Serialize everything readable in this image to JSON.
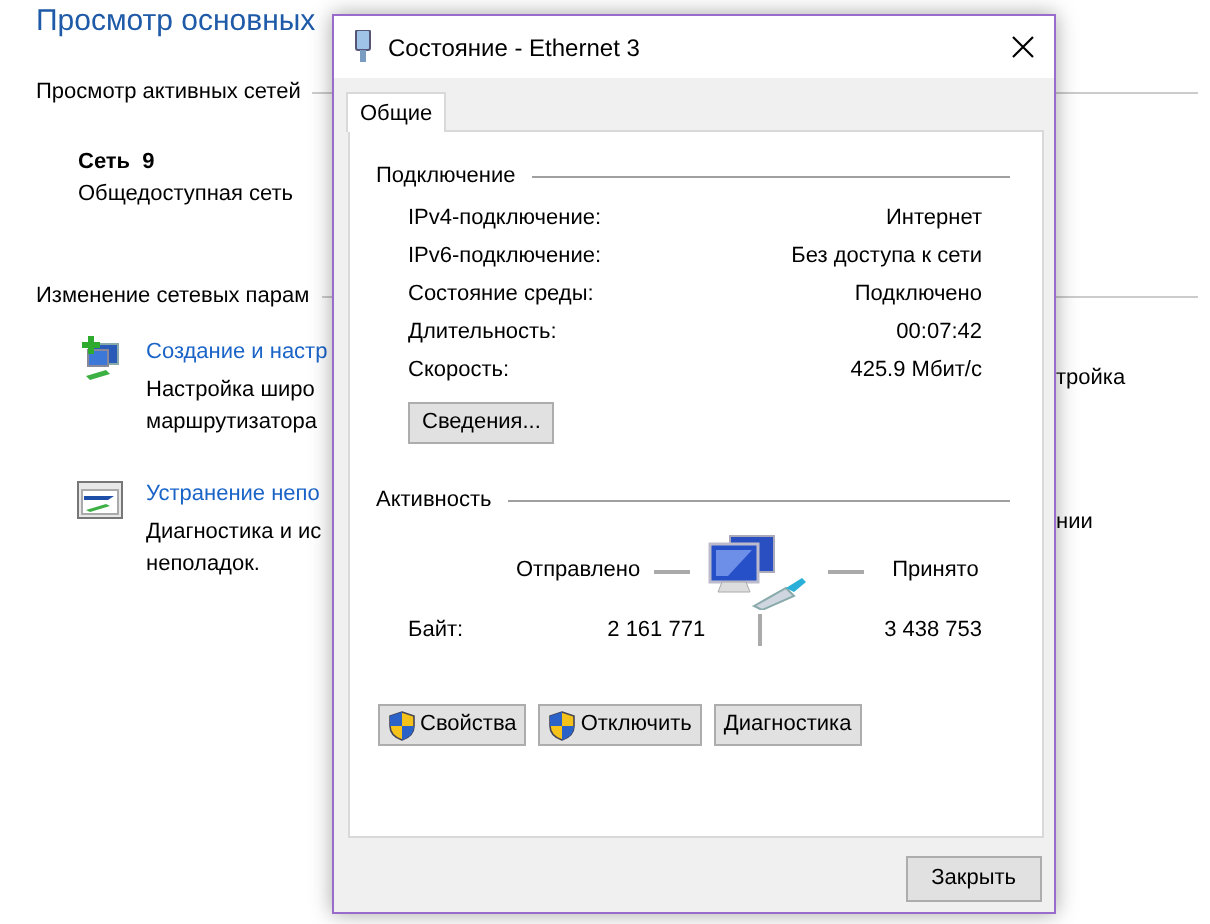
{
  "background": {
    "title": "Просмотр основных",
    "active_networks_heading": "Просмотр активных сетей",
    "network": {
      "name": "Сеть  9",
      "category": "Общедоступная сеть"
    },
    "settings_heading": "Изменение сетевых парам",
    "tasks": [
      {
        "kind": "setup",
        "link": "Создание и настр",
        "lines": [
          "Настройка широ",
          "маршрутизатора"
        ],
        "right_fragment": "тройка"
      },
      {
        "kind": "troubleshoot",
        "link": "Устранение непо",
        "lines": [
          "Диагностика и ис",
          "неполадок."
        ],
        "right_fragment": "нии"
      }
    ]
  },
  "dialog": {
    "title": "Состояние - Ethernet 3",
    "tabs": [
      {
        "label": "Общие",
        "selected": true
      }
    ],
    "connection": {
      "heading": "Подключение",
      "rows": [
        {
          "label": "IPv4-подключение:",
          "value": "Интернет"
        },
        {
          "label": "IPv6-подключение:",
          "value": "Без доступа к сети"
        },
        {
          "label": "Состояние среды:",
          "value": "Подключено"
        },
        {
          "label": "Длительность:",
          "value": "00:07:42"
        },
        {
          "label": "Скорость:",
          "value": "425.9 Мбит/с"
        }
      ],
      "details_button": "Сведения..."
    },
    "activity": {
      "heading": "Активность",
      "sent_label": "Отправлено",
      "received_label": "Принято",
      "bytes_label": "Байт:",
      "sent": "2 161 771",
      "received": "3 438 753"
    },
    "buttons": [
      {
        "label": "Свойства",
        "shield": true
      },
      {
        "label": "Отключить",
        "shield": true
      },
      {
        "label": "Диагностика",
        "shield": false
      }
    ],
    "close_button": "Закрыть"
  }
}
